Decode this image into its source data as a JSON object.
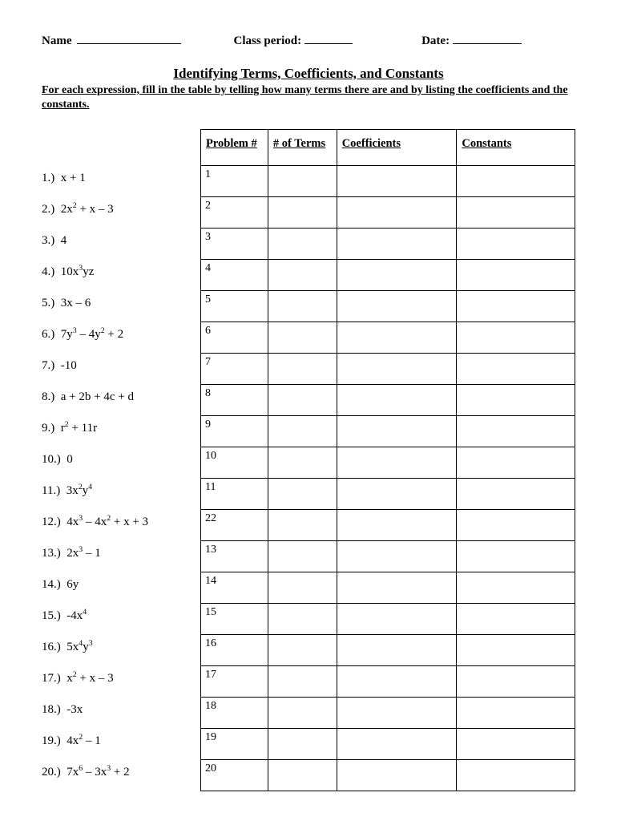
{
  "header": {
    "name_label": "Name",
    "class_label": "Class period:",
    "date_label": "Date:"
  },
  "title": "Identifying Terms, Coefficients, and Constants",
  "instructions": "For each expression, fill in the table by telling how many terms there are and by listing the coefficients and the constants.",
  "columns": {
    "problem": "Problem #",
    "terms": "# of Terms",
    "coeff": "Coefficients",
    "const": "Constants"
  },
  "problems": [
    {
      "num": "1.)",
      "expr": "x + 1"
    },
    {
      "num": "2.)",
      "expr": "2x<sup>2</sup> + x – 3"
    },
    {
      "num": "3.)",
      "expr": "4"
    },
    {
      "num": "4.)",
      "expr": "10x<sup>3</sup>yz"
    },
    {
      "num": "5.)",
      "expr": "3x – 6"
    },
    {
      "num": "6.)",
      "expr": "7y<sup>3</sup> – 4y<sup>2</sup> + 2"
    },
    {
      "num": "7.)",
      "expr": "-10"
    },
    {
      "num": "8.)",
      "expr": "a + 2b + 4c + d"
    },
    {
      "num": "9.)",
      "expr": "r<sup>2</sup> + 11r"
    },
    {
      "num": "10.)",
      "expr": "0"
    },
    {
      "num": "11.)",
      "expr": "3x<sup>2</sup>y<sup>4</sup>"
    },
    {
      "num": "12.)",
      "expr": "4x<sup>3</sup> – 4x<sup>2</sup> + x + 3"
    },
    {
      "num": "13.)",
      "expr": "2x<sup>3</sup> – 1"
    },
    {
      "num": "14.)",
      "expr": "6y"
    },
    {
      "num": "15.)",
      "expr": "-4x<sup>4</sup>"
    },
    {
      "num": "16.)",
      "expr": "5x<sup>4</sup>y<sup>3</sup>"
    },
    {
      "num": "17.)",
      "expr": "x<sup>2</sup> + x – 3"
    },
    {
      "num": "18.)",
      "expr": "-3x"
    },
    {
      "num": "19.)",
      "expr": "4x<sup>2</sup> – 1"
    },
    {
      "num": "20.)",
      "expr": "7x<sup>6</sup> – 3x<sup>3</sup> + 2"
    }
  ],
  "row_numbers": [
    "1",
    "2",
    "3",
    "4",
    "5",
    "6",
    "7",
    "8",
    "9",
    "10",
    "11",
    "22",
    "13",
    "14",
    "15",
    "16",
    "17",
    "18",
    "19",
    "20"
  ]
}
